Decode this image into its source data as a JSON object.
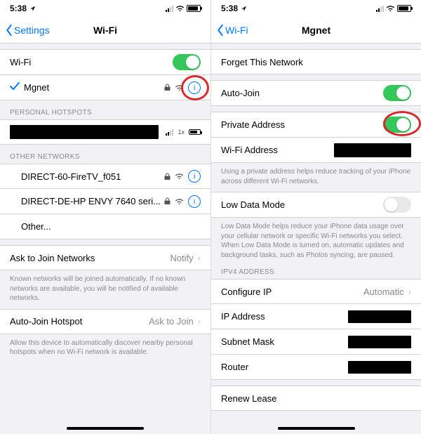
{
  "left": {
    "status": {
      "time": "5:38",
      "loc_arrow": "↖"
    },
    "nav": {
      "back": "Settings",
      "title": "Wi-Fi"
    },
    "wifi_master": "Wi-Fi",
    "connected": {
      "name": "Mgnet"
    },
    "hotspots_hdr": "PERSONAL HOTSPOTS",
    "hotspot_signal": "1x",
    "other_hdr": "OTHER NETWORKS",
    "networks": [
      {
        "name": "DIRECT-60-FireTV_f051",
        "locked": true
      },
      {
        "name": "DIRECT-DE-HP ENVY 7640 seri...",
        "locked": true
      }
    ],
    "other_label": "Other...",
    "ask_join": {
      "label": "Ask to Join Networks",
      "value": "Notify"
    },
    "ask_join_footer": "Known networks will be joined automatically. If no known networks are available, you will be notified of available networks.",
    "auto_hotspot": {
      "label": "Auto-Join Hotspot",
      "value": "Ask to Join"
    },
    "auto_hotspot_footer": "Allow this device to automatically discover nearby personal hotspots when no Wi-Fi network is available."
  },
  "right": {
    "status": {
      "time": "5:38",
      "loc_arrow": "↖"
    },
    "nav": {
      "back": "Wi-Fi",
      "title": "Mgnet"
    },
    "forget": "Forget This Network",
    "auto_join": "Auto-Join",
    "private_addr": "Private Address",
    "wifi_addr": "Wi-Fi Address",
    "private_footer": "Using a private address helps reduce tracking of your iPhone across different Wi-Fi networks.",
    "low_data": "Low Data Mode",
    "low_data_footer": "Low Data Mode helps reduce your iPhone data usage over your cellular network or specific Wi-Fi networks you select. When Low Data Mode is turned on, automatic updates and background tasks, such as Photos syncing, are paused.",
    "ipv4_hdr": "IPV4 ADDRESS",
    "configure_ip": {
      "label": "Configure IP",
      "value": "Automatic"
    },
    "ip_addr": "IP Address",
    "subnet": "Subnet Mask",
    "router": "Router",
    "renew": "Renew Lease"
  }
}
